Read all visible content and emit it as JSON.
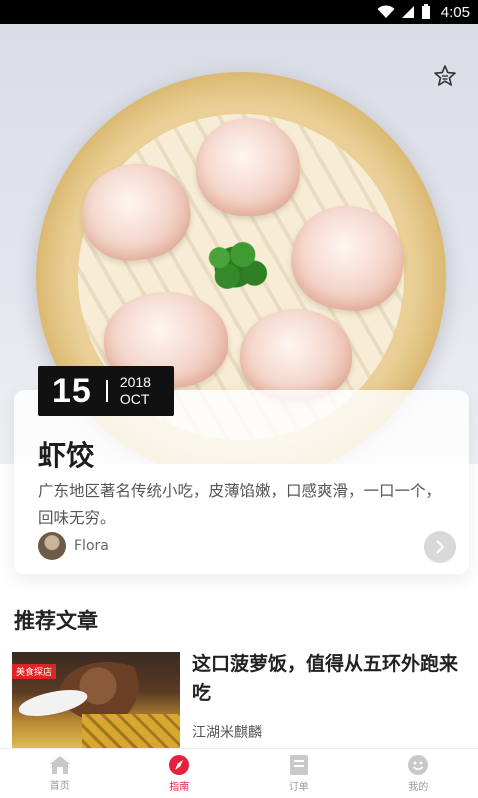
{
  "status_bar": {
    "time": "4:05"
  },
  "hero": {
    "image": "shrimp-dumplings-in-bamboo-steamer",
    "date": {
      "day": "15",
      "year": "2018",
      "month": "OCT"
    },
    "title": "虾饺",
    "description": "广东地区著名传统小吃，皮薄馅嫩，口感爽滑，一口一个，回味无穷。",
    "author": "Flora"
  },
  "section": {
    "title": "推荐文章",
    "article": {
      "tag": "美食探店",
      "title": "这口菠萝饭，值得从五环外跑来吃",
      "author": "江湖米麒麟"
    }
  },
  "tabs": [
    {
      "label": "首页",
      "icon": "home-icon"
    },
    {
      "label": "指南",
      "icon": "compass-icon",
      "active": true
    },
    {
      "label": "订单",
      "icon": "order-icon"
    },
    {
      "label": "我的",
      "icon": "profile-icon"
    }
  ],
  "colors": {
    "accent": "#e4223a",
    "date_bg": "#111111"
  }
}
